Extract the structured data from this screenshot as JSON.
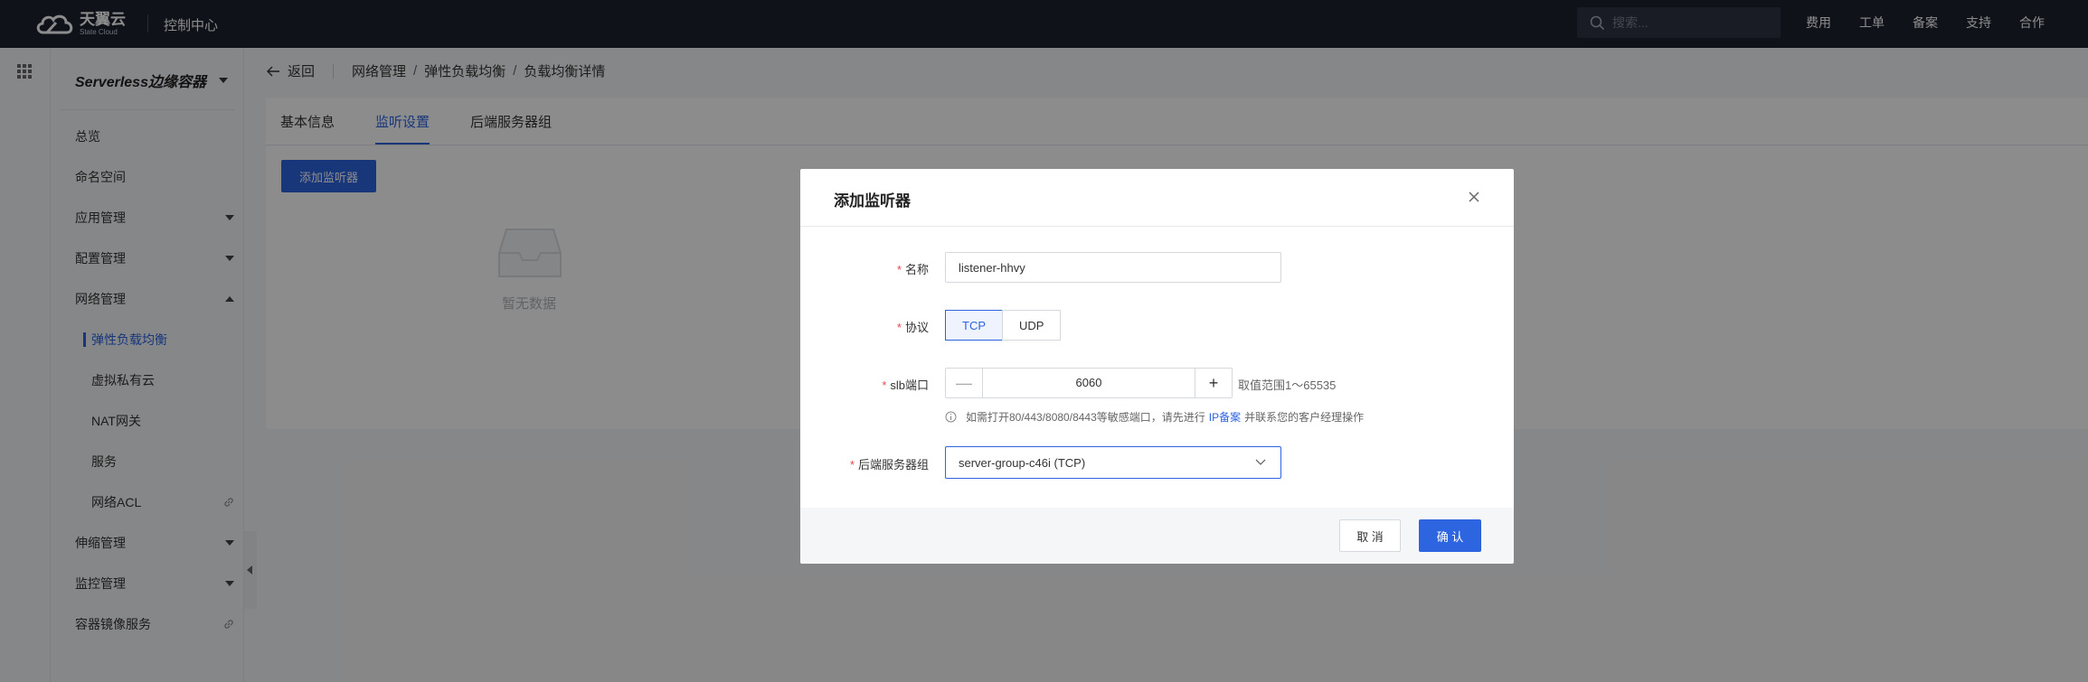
{
  "topbar": {
    "logo_cn": "天翼云",
    "logo_en": "State Cloud",
    "console": "控制中心",
    "search_placeholder": "搜索...",
    "links": [
      "费用",
      "工单",
      "备案",
      "支持",
      "合作"
    ]
  },
  "sidebar": {
    "title": "Serverless边缘容器",
    "items": [
      {
        "label": "总览"
      },
      {
        "label": "命名空间"
      },
      {
        "label": "应用管理"
      },
      {
        "label": "配置管理"
      },
      {
        "label": "网络管理"
      },
      {
        "label": "弹性负载均衡"
      },
      {
        "label": "虚拟私有云"
      },
      {
        "label": "NAT网关"
      },
      {
        "label": "服务"
      },
      {
        "label": "网络ACL"
      },
      {
        "label": "伸缩管理"
      },
      {
        "label": "监控管理"
      },
      {
        "label": "容器镜像服务"
      }
    ]
  },
  "breadcrumb": {
    "back": "返回",
    "crumbs": [
      "网络管理",
      "弹性负载均衡",
      "负载均衡详情"
    ]
  },
  "tabs": [
    "基本信息",
    "监听设置",
    "后端服务器组"
  ],
  "add_button": "添加监听器",
  "empty_text": "暂无数据",
  "modal": {
    "title": "添加监听器",
    "name_label": "名称",
    "name_value": "listener-hhvy",
    "protocol_label": "协议",
    "protocol_options": [
      "TCP",
      "UDP"
    ],
    "port_label": "slb端口",
    "port_value": "6060",
    "port_range": "取值范围1～65535",
    "tip_prefix": "如需打开80/443/8080/8443等敏感端口，请先进行",
    "tip_link": "IP备案",
    "tip_suffix": "并联系您的客户经理操作",
    "group_label": "后端服务器组",
    "group_value": "server-group-c46i (TCP)",
    "cancel": "取 消",
    "confirm": "确 认"
  },
  "colors": {
    "accent": "#2d64e0",
    "topbar": "#1e2230",
    "required": "#e5484d"
  }
}
